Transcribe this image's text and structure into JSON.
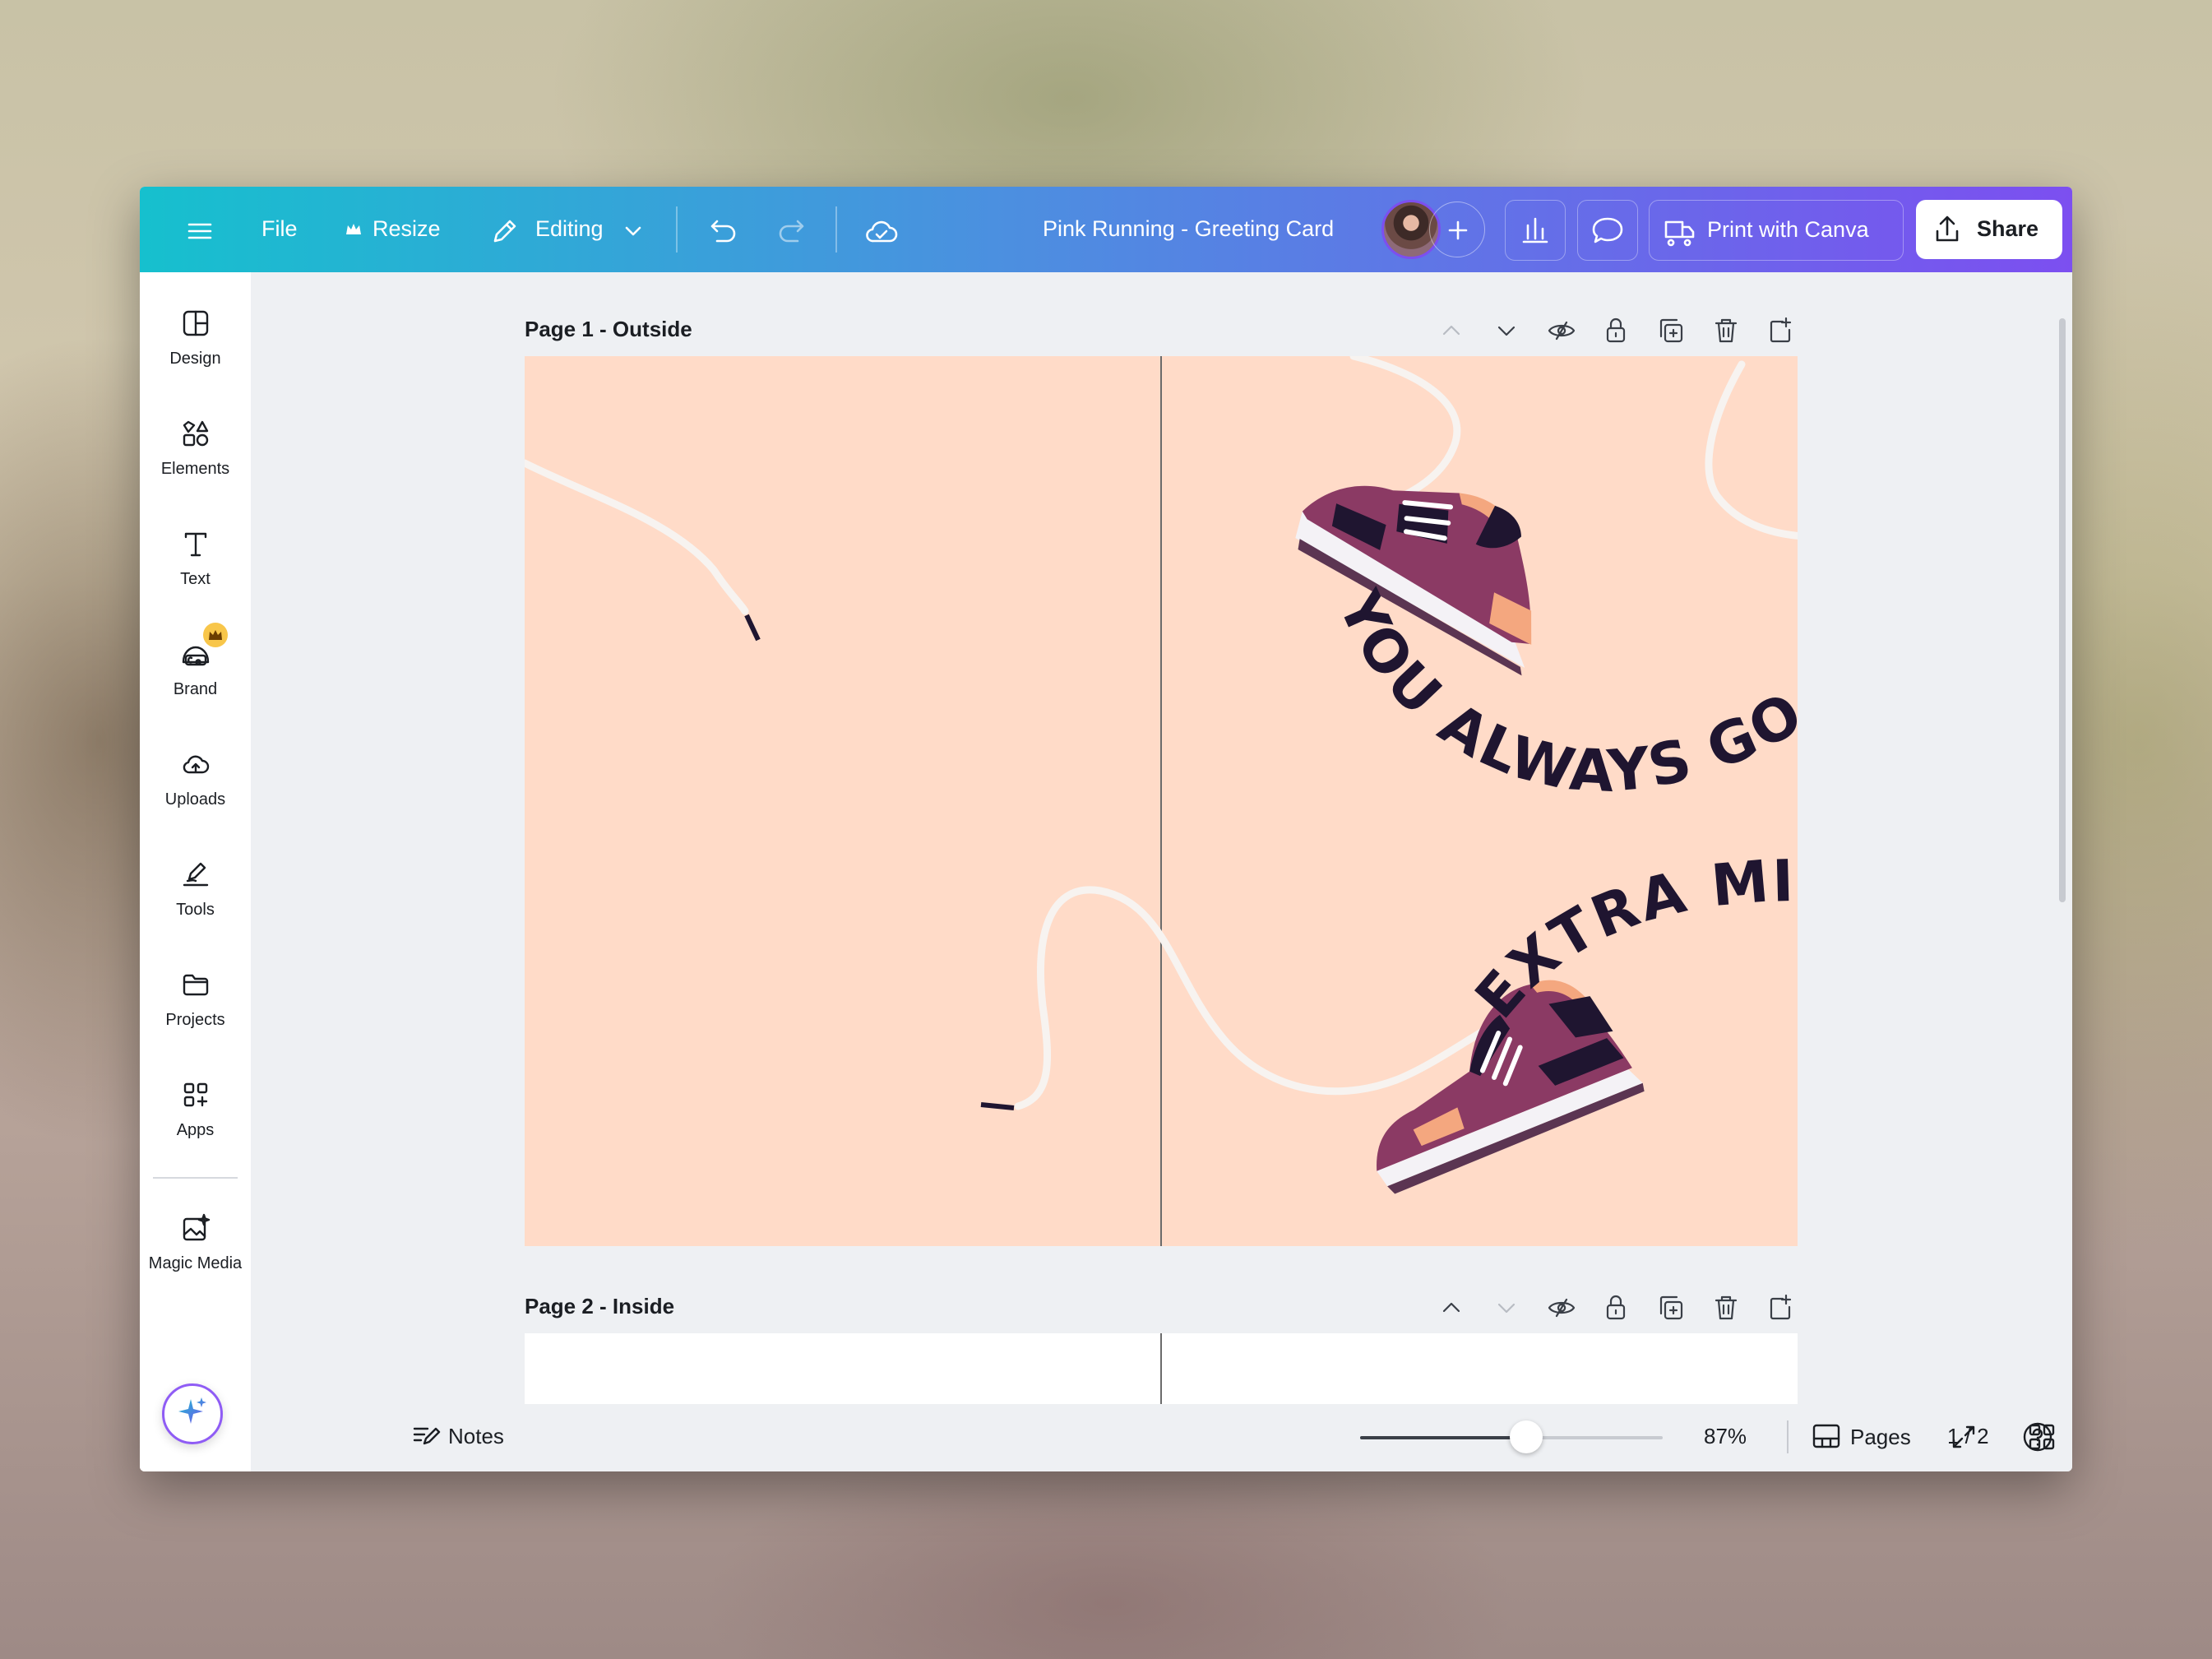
{
  "toolbar": {
    "file_label": "File",
    "resize_label": "Resize",
    "editing_label": "Editing",
    "doc_title": "Pink Running - Greeting Card",
    "print_label": "Print with Canva",
    "share_label": "Share"
  },
  "sidebar": {
    "items": [
      {
        "label": "Design",
        "icon": "layout-icon"
      },
      {
        "label": "Elements",
        "icon": "shapes-icon"
      },
      {
        "label": "Text",
        "icon": "text-icon"
      },
      {
        "label": "Brand",
        "icon": "brand-icon"
      },
      {
        "label": "Uploads",
        "icon": "cloud-upload-icon"
      },
      {
        "label": "Tools",
        "icon": "pen-icon"
      },
      {
        "label": "Projects",
        "icon": "folder-icon"
      },
      {
        "label": "Apps",
        "icon": "apps-icon"
      },
      {
        "label": "Magic Media",
        "icon": "magic-media-icon"
      }
    ]
  },
  "pages": [
    {
      "title": "Page 1 - Outside"
    },
    {
      "title": "Page 2 - Inside"
    }
  ],
  "design": {
    "text_line1": "YOU ALWAYS GO THE",
    "text_line2": "EXTRA MILE",
    "background_color": "#ffdbc8",
    "shoe_color": "#8b3a64"
  },
  "bottombar": {
    "notes_label": "Notes",
    "zoom_value": "87%",
    "zoom_level": 0.55,
    "pages_label": "Pages",
    "page_counter": "1 / 2"
  },
  "colors": {
    "toolbar_start": "#16c0ce",
    "toolbar_end": "#7c4ff0",
    "brand_badge": "#f8c64a"
  }
}
